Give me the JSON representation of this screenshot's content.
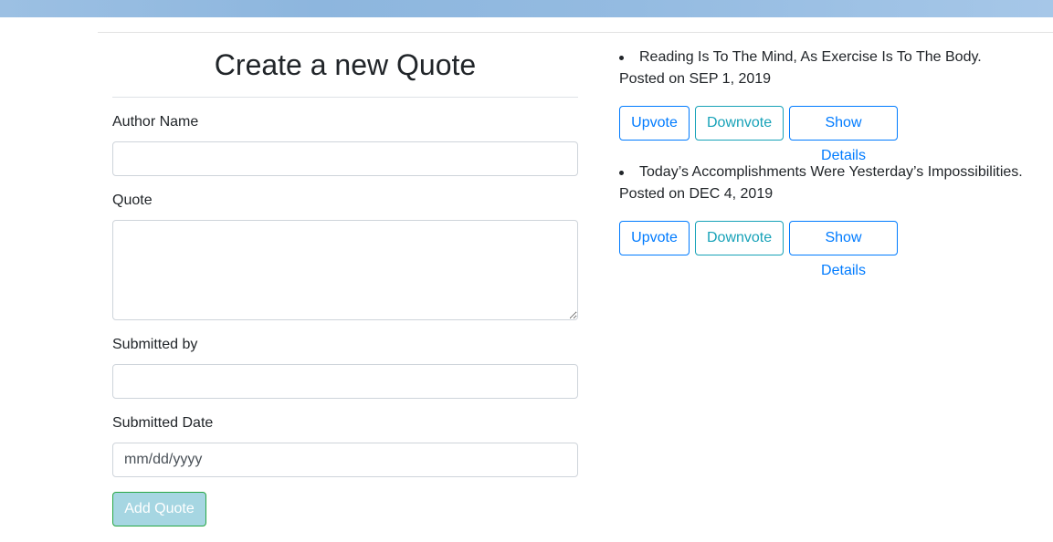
{
  "form": {
    "title": "Create a new Quote",
    "author_label": "Author Name",
    "author_value": "",
    "quote_label": "Quote",
    "quote_value": "",
    "submitted_by_label": "Submitted by",
    "submitted_by_value": "",
    "date_label": "Submitted Date",
    "date_placeholder": "mm/dd/yyyy",
    "submit_label": "Add Quote"
  },
  "quotes": [
    {
      "text": "Reading Is To The Mind, As Exercise Is To The Body.",
      "posted": "Posted on SEP 1, 2019",
      "upvote_label": "Upvote",
      "downvote_label": "Downvote",
      "details_label": "Show Details"
    },
    {
      "text": "Today’s Accomplishments Were Yesterday’s Impossibilities.",
      "posted": "Posted on DEC 4, 2019",
      "upvote_label": "Upvote",
      "downvote_label": "Downvote",
      "details_label": "Show Details"
    }
  ],
  "colors": {
    "primary": "#007bff",
    "info": "#17a2b8",
    "success_border": "#28a745",
    "submit_fill": "#a6d6e2",
    "banner": "#8db6de"
  }
}
